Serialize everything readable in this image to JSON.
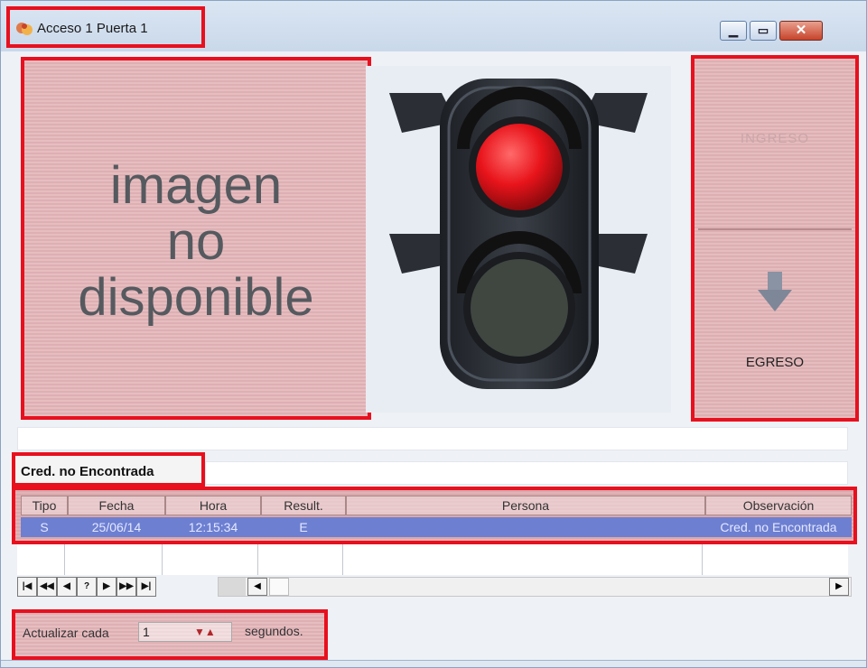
{
  "window": {
    "title": "Acceso 1 Puerta 1",
    "min_glyph": "▁",
    "max_glyph": "▭",
    "close_glyph": "✕"
  },
  "photo": {
    "line1": "imagen",
    "line2": "no",
    "line3": "disponible"
  },
  "traffic_light": {
    "state": "red",
    "top_light_color": "#e8141b",
    "bottom_light_color": "#404741"
  },
  "actions": {
    "ingreso_label": "INGRESO",
    "egreso_label": "EGRESO"
  },
  "status": {
    "message": "Cred. no Encontrada"
  },
  "grid": {
    "columns": [
      "Tipo",
      "Fecha",
      "Hora",
      "Result.",
      "Persona",
      "Observación"
    ],
    "rows": [
      {
        "tipo": "S",
        "fecha": "25/06/14",
        "hora": "12:15:34",
        "result": "E",
        "persona": "",
        "observacion": "Cred. no Encontrada"
      }
    ]
  },
  "navigator": {
    "buttons": [
      "|◀",
      "◀◀",
      "◀",
      "?",
      "▶",
      "▶▶",
      "▶|"
    ]
  },
  "refresh": {
    "label": "Actualizar cada",
    "value": "1",
    "unit": "segundos."
  },
  "colors": {
    "highlight": "#e8101e",
    "selected_row": "#6d7fd1"
  }
}
